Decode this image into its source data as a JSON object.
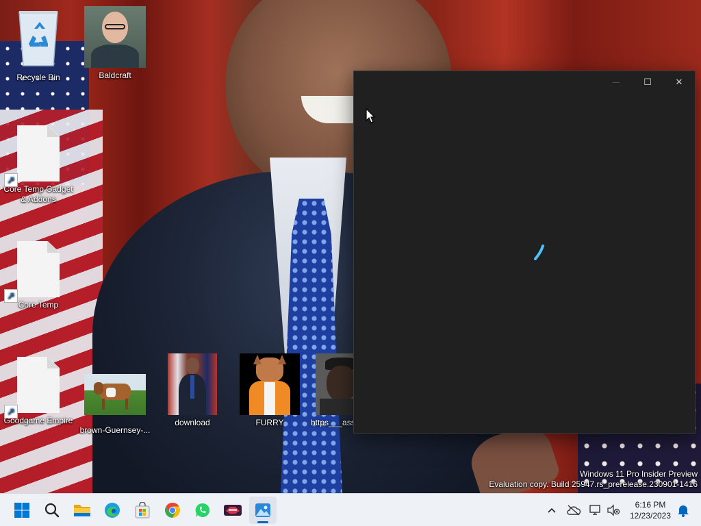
{
  "desktop": {
    "icons": [
      {
        "label": "Recycle Bin",
        "type": "recycle-bin"
      },
      {
        "label": "Baldcraft",
        "type": "image"
      },
      {
        "label": "Core Temp Gadget & Addons",
        "type": "shortcut"
      },
      {
        "label": "Core Temp",
        "type": "shortcut"
      },
      {
        "label": "Goodgame Empire",
        "type": "shortcut"
      },
      {
        "label": "brown-Guernsey-...",
        "type": "image"
      },
      {
        "label": "download",
        "type": "image"
      },
      {
        "label": "FURRY",
        "type": "image"
      },
      {
        "label": "https___asse",
        "type": "image"
      }
    ]
  },
  "window": {
    "state": "loading",
    "background_color": "#202020",
    "spinner_color": "#4cc2ff",
    "caption": {
      "minimize": "—",
      "maximize": "☐",
      "close": "✕"
    }
  },
  "watermark": {
    "line1": "Windows 11 Pro Insider Preview",
    "line2": "Evaluation copy. Build 25947.rs_prerelease.230901-1416"
  },
  "taskbar": {
    "pinned": [
      {
        "name": "start",
        "icon": "windows-logo-icon"
      },
      {
        "name": "search",
        "icon": "search-icon"
      },
      {
        "name": "file-explorer",
        "icon": "folder-icon"
      },
      {
        "name": "edge",
        "icon": "edge-icon"
      },
      {
        "name": "microsoft-store",
        "icon": "store-icon"
      },
      {
        "name": "chrome",
        "icon": "chrome-icon"
      },
      {
        "name": "whatsapp",
        "icon": "whatsapp-icon"
      },
      {
        "name": "game",
        "icon": "game-icon"
      },
      {
        "name": "photos",
        "icon": "photos-icon",
        "active": true
      }
    ],
    "tray": {
      "overflow": "^",
      "time": "6:16 PM",
      "date": "12/23/2023"
    },
    "accent_color": "#0067c0"
  }
}
